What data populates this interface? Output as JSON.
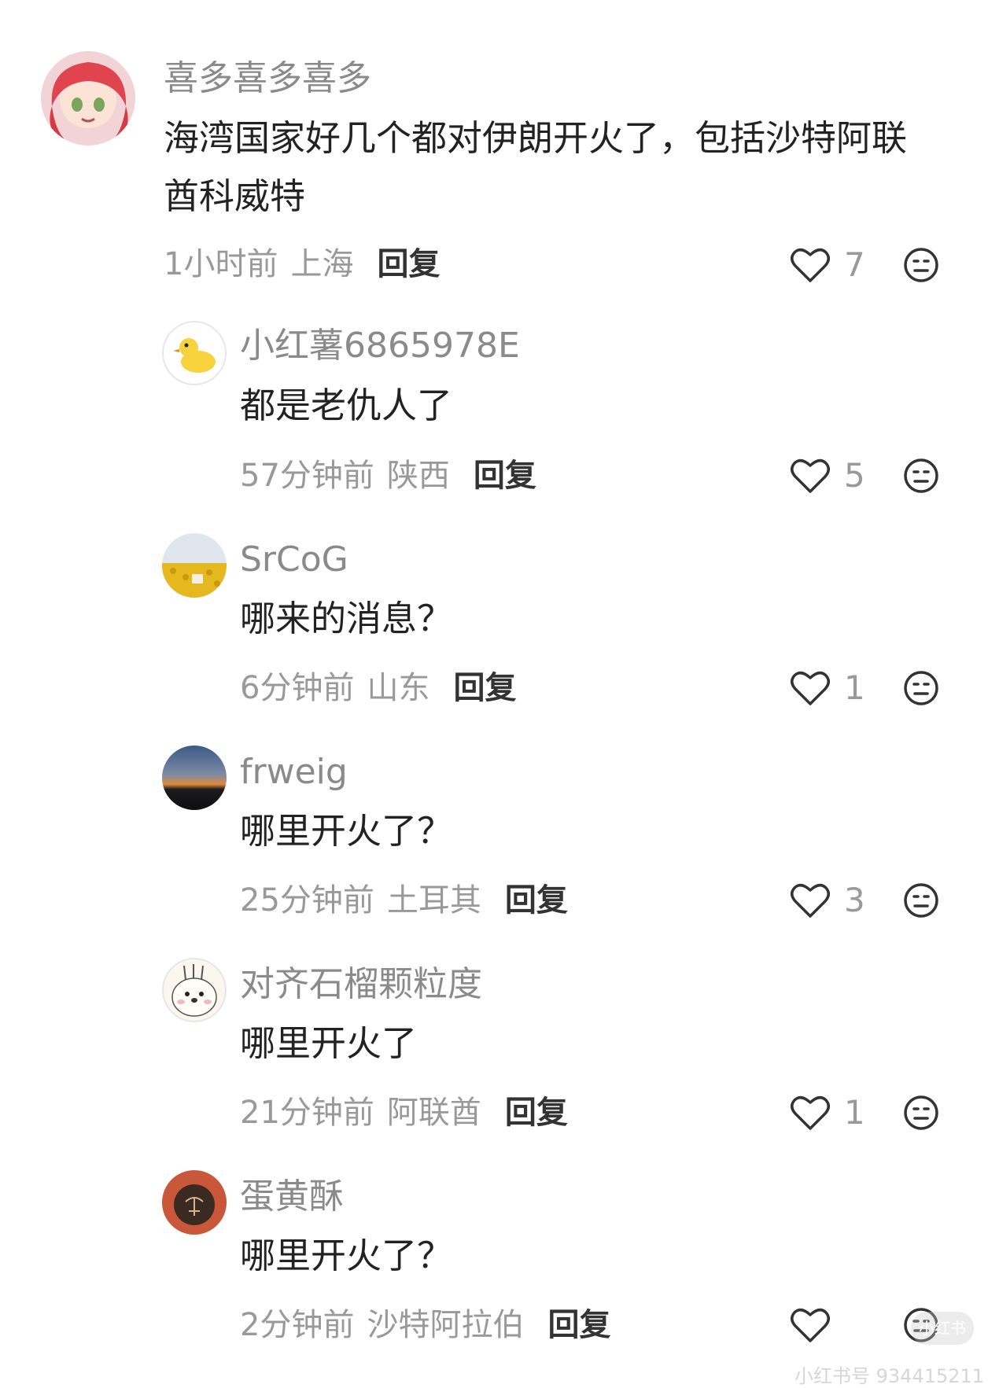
{
  "comments": [
    {
      "username": "喜多喜多喜多",
      "content_lines": [
        "海湾国家好几个都对伊朗开火了，包括沙特阿联",
        "酋科威特"
      ],
      "time": "1小时前",
      "location": "上海",
      "reply_label": "回复",
      "likes": "7"
    },
    {
      "username": "小红薯6865978E",
      "content_lines": [
        "都是老仇人了"
      ],
      "time": "57分钟前",
      "location": "陕西",
      "reply_label": "回复",
      "likes": "5"
    },
    {
      "username": "SrCoG",
      "content_lines": [
        "哪来的消息？"
      ],
      "time": "6分钟前",
      "location": "山东",
      "reply_label": "回复",
      "likes": "1"
    },
    {
      "username": "frweig",
      "content_lines": [
        "哪里开火了？"
      ],
      "time": "25分钟前",
      "location": "土耳其",
      "reply_label": "回复",
      "likes": "3"
    },
    {
      "username": "对齐石榴颗粒度",
      "content_lines": [
        "哪里开火了"
      ],
      "time": "21分钟前",
      "location": "阿联酋",
      "reply_label": "回复",
      "likes": "1"
    },
    {
      "username": "蛋黄酥",
      "content_lines": [
        "哪里开火了？"
      ],
      "time": "2分钟前",
      "location": "沙特阿拉伯",
      "reply_label": "回复",
      "likes": ""
    }
  ],
  "icons": {
    "like": "heart-outline-icon",
    "dislike": "neutral-face-icon"
  },
  "colors": {
    "username": "#8a8a8a",
    "meta": "#999999",
    "content": "#222222",
    "reply": "#333333"
  },
  "watermark": {
    "text": "小红书号 934415211",
    "badge": "小红书"
  }
}
